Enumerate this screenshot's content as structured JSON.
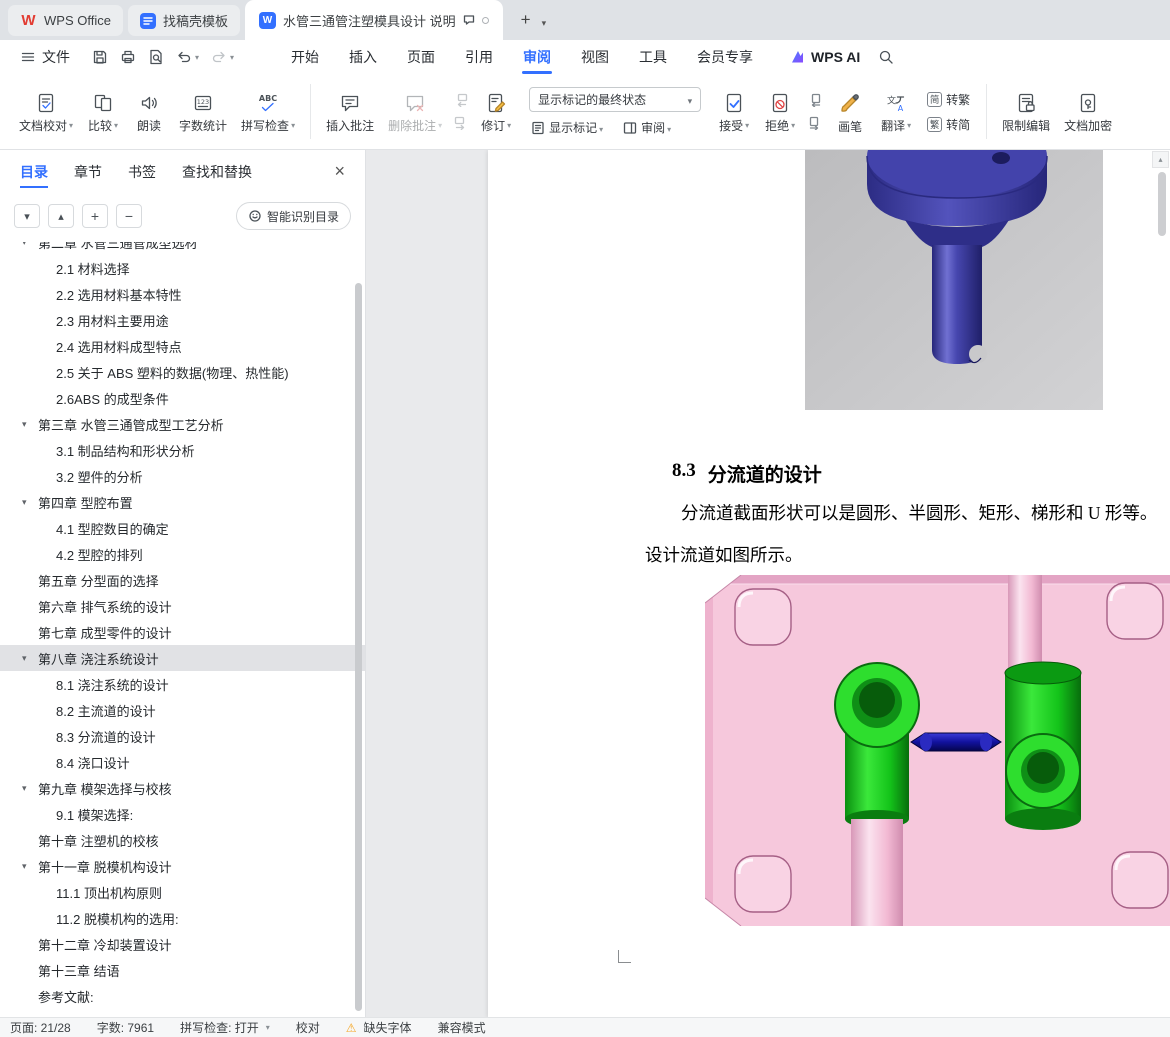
{
  "window_tabs": {
    "home": "WPS Office",
    "template_doc": "找稿壳模板",
    "document": "水管三通管注塑模具设计 说明"
  },
  "menu": {
    "file": "文件",
    "items": [
      "开始",
      "插入",
      "页面",
      "引用",
      "审阅",
      "视图",
      "工具",
      "会员专享"
    ],
    "wps_ai": "WPS AI"
  },
  "ribbon": {
    "doc_proof": "文档校对",
    "compare": "比较",
    "read_aloud": "朗读",
    "word_count": "字数统计",
    "spell_check": "拼写检查",
    "insert_comment": "插入批注",
    "delete_comment": "删除批注",
    "track_changes": "修订",
    "display_state": "显示标记的最终状态",
    "show_markup": "显示标记",
    "review_pane": "审阅",
    "accept": "接受",
    "reject": "拒绝",
    "brush": "画笔",
    "translate": "翻译",
    "to_traditional": "转繁",
    "to_simplified": "转简",
    "to_traditional_glyph": "简",
    "to_simplified_glyph": "繁",
    "restrict_edit": "限制编辑",
    "encrypt": "文档加密"
  },
  "sidebar": {
    "tabs": [
      "目录",
      "章节",
      "书签",
      "查找和替换"
    ],
    "smart_button": "智能识别目录",
    "outline": [
      {
        "level": 1,
        "caret": true,
        "label": "第二章 水管三通管成型选材"
      },
      {
        "level": 2,
        "caret": false,
        "label": "2.1 材料选择"
      },
      {
        "level": 2,
        "caret": false,
        "label": "2.2 选用材料基本特性"
      },
      {
        "level": 2,
        "caret": false,
        "label": "2.3 用材料主要用途"
      },
      {
        "level": 2,
        "caret": false,
        "label": "2.4 选用材料成型特点"
      },
      {
        "level": 2,
        "caret": false,
        "label": "2.5 关于 ABS 塑料的数据(物理、热性能)"
      },
      {
        "level": 2,
        "caret": false,
        "label": "2.6ABS 的成型条件"
      },
      {
        "level": 1,
        "caret": true,
        "label": "第三章 水管三通管成型工艺分析"
      },
      {
        "level": 2,
        "caret": false,
        "label": "3.1 制品结构和形状分析"
      },
      {
        "level": 2,
        "caret": false,
        "label": "3.2 塑件的分析"
      },
      {
        "level": 1,
        "caret": true,
        "label": "第四章 型腔布置"
      },
      {
        "level": 2,
        "caret": false,
        "label": "4.1 型腔数目的确定"
      },
      {
        "level": 2,
        "caret": false,
        "label": "4.2 型腔的排列"
      },
      {
        "level": 1,
        "caret": false,
        "label": "第五章 分型面的选择"
      },
      {
        "level": 1,
        "caret": false,
        "label": "第六章 排气系统的设计"
      },
      {
        "level": 1,
        "caret": false,
        "label": "第七章 成型零件的设计"
      },
      {
        "level": 1,
        "caret": true,
        "selected": true,
        "label": "第八章 浇注系统设计"
      },
      {
        "level": 2,
        "caret": false,
        "label": "8.1 浇注系统的设计"
      },
      {
        "level": 2,
        "caret": false,
        "label": "8.2 主流道的设计"
      },
      {
        "level": 2,
        "caret": false,
        "label": "8.3 分流道的设计"
      },
      {
        "level": 2,
        "caret": false,
        "label": "8.4 浇口设计"
      },
      {
        "level": 1,
        "caret": true,
        "label": "第九章 模架选择与校核"
      },
      {
        "level": 2,
        "caret": false,
        "label": "9.1 模架选择:"
      },
      {
        "level": 1,
        "caret": false,
        "label": "第十章 注塑机的校核"
      },
      {
        "level": 1,
        "caret": true,
        "label": "第十一章 脱模机构设计"
      },
      {
        "level": 2,
        "caret": false,
        "label": "11.1 顶出机构原则"
      },
      {
        "level": 2,
        "caret": false,
        "label": "11.2 脱模机构的选用:"
      },
      {
        "level": 1,
        "caret": false,
        "label": "第十二章 冷却装置设计"
      },
      {
        "level": 1,
        "caret": false,
        "label": "第十三章 结语"
      },
      {
        "level": 1,
        "caret": false,
        "label": "参考文献:"
      }
    ]
  },
  "document": {
    "heading_number": "8.3",
    "heading_title": "分流道的设计",
    "paragraph1": "分流道截面形状可以是圆形、半圆形、矩形、梯形和 U 形等。",
    "paragraph2": "设计流道如图所示。"
  },
  "statusbar": {
    "page": "页面: 21/28",
    "words": "字数: 7961",
    "spellcheck": "拼写检查: 打开",
    "proofread": "校对",
    "missing_font": "缺失字体",
    "compat_mode": "兼容模式"
  },
  "colors": {
    "accent": "#3370ff",
    "warning": "#f5a623",
    "sprue_blue": "#4343ab",
    "fitting_green": "#1ec91e",
    "plate_pink": "#f6c8dc",
    "runner_blue": "#12129e"
  }
}
